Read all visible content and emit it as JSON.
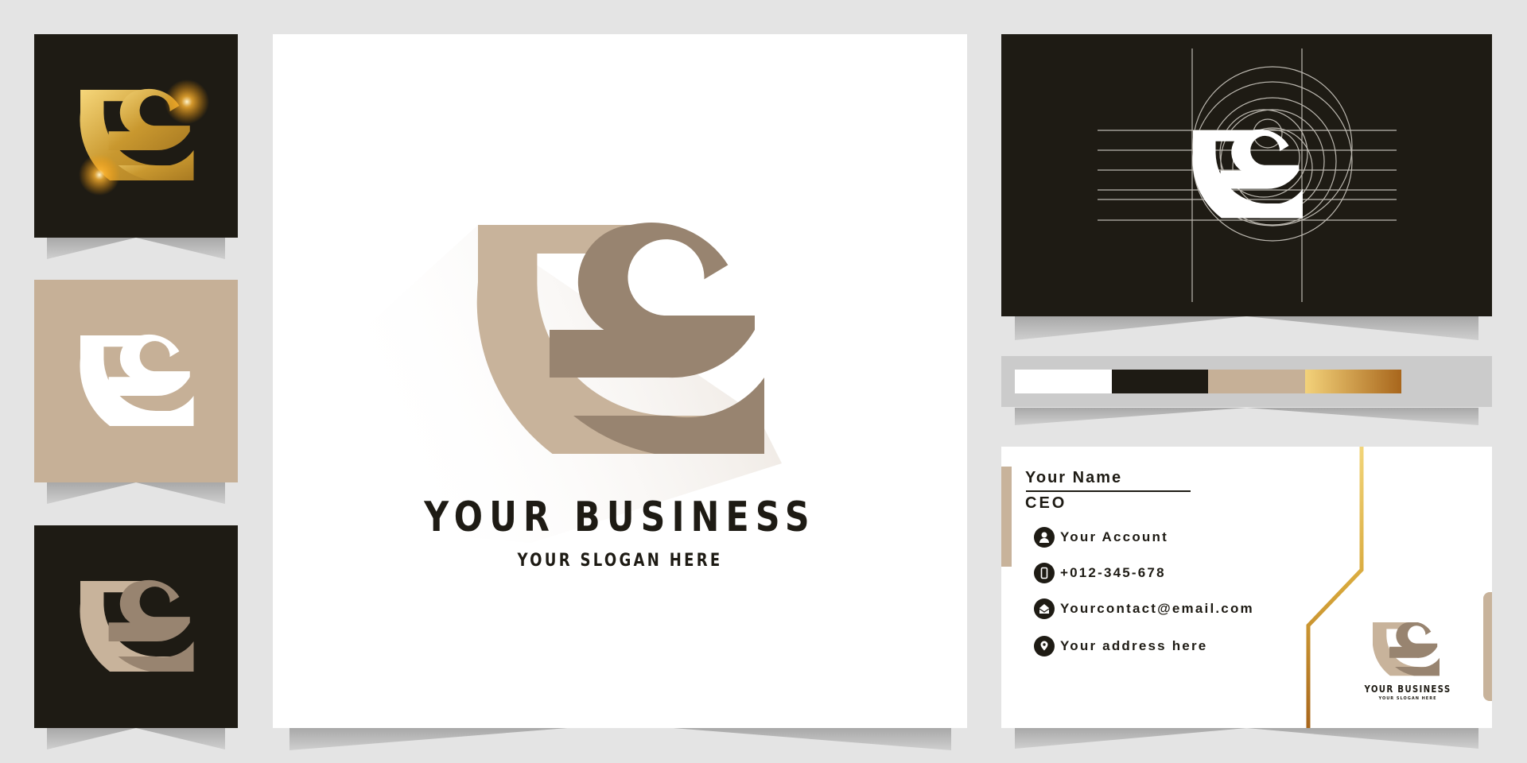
{
  "brand": {
    "business_name": "YOUR BUSINESS",
    "slogan": "YOUR SLOGAN HERE",
    "monogram": "TC"
  },
  "palette": {
    "swatches": [
      {
        "name": "white",
        "color": "#ffffff"
      },
      {
        "name": "black",
        "color": "#1e1b14"
      },
      {
        "name": "tan",
        "color": "#c6b097"
      },
      {
        "name": "gold-gradient",
        "color": "#f3d27a",
        "color_end": "#a8661c"
      }
    ],
    "logo_light": "#c8b39b",
    "logo_dark": "#988470"
  },
  "business_card": {
    "name": "Your Name",
    "role": "CEO",
    "contacts": [
      {
        "icon": "user-icon",
        "text": "Your Account"
      },
      {
        "icon": "phone-icon",
        "text": "+012-345-678"
      },
      {
        "icon": "email-icon",
        "text": "Yourcontact@email.com"
      },
      {
        "icon": "location-pin-icon",
        "text": "Your address here"
      }
    ],
    "logo_business_name": "YOUR BUSINESS",
    "logo_slogan": "YOUR SLOGAN HERE"
  }
}
